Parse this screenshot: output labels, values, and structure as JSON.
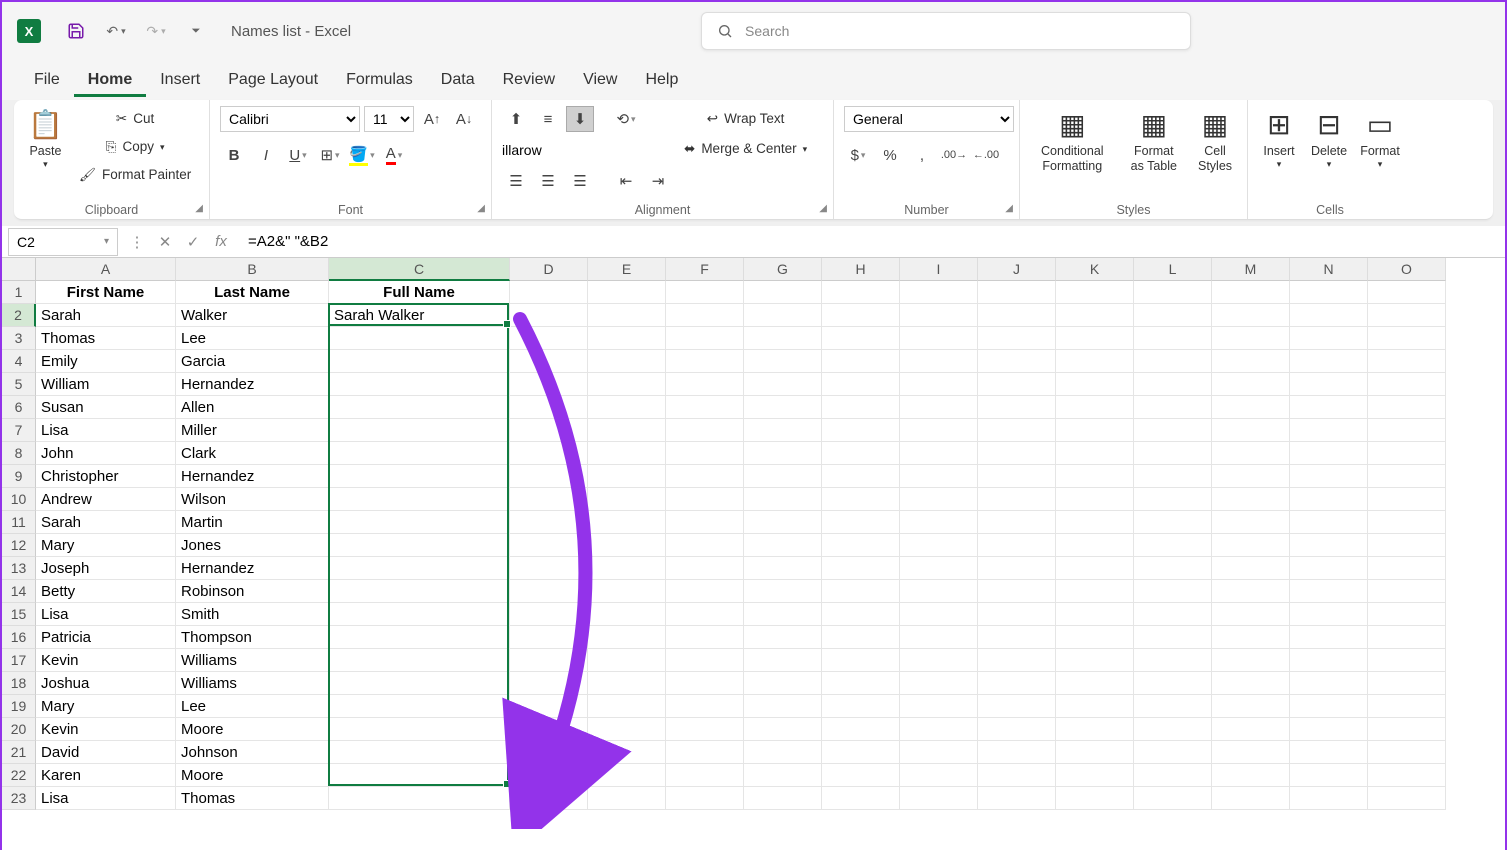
{
  "title": "Names list  -  Excel",
  "search_placeholder": "Search",
  "tabs": [
    "File",
    "Home",
    "Insert",
    "Page Layout",
    "Formulas",
    "Data",
    "Review",
    "View",
    "Help"
  ],
  "active_tab": 1,
  "clipboard": {
    "paste": "Paste",
    "cut": "Cut",
    "copy": "Copy",
    "painter": "Format Painter",
    "label": "Clipboard"
  },
  "font": {
    "name": "Calibri",
    "size": "11",
    "label": "Font"
  },
  "alignment": {
    "wrap": "Wrap Text",
    "merge": "Merge & Center",
    "label": "Alignment"
  },
  "number": {
    "format": "General",
    "label": "Number"
  },
  "styles": {
    "cf": "Conditional Formatting",
    "fat": "Format as Table",
    "cs": "Cell Styles",
    "label": "Styles"
  },
  "cells": {
    "insert": "Insert",
    "delete": "Delete",
    "format": "Format",
    "label": "Cells"
  },
  "name_box": "C2",
  "formula": "=A2&\" \"&B2",
  "col_widths": {
    "A": 140,
    "B": 153,
    "C": 181,
    "other": 78
  },
  "columns": [
    "A",
    "B",
    "C",
    "D",
    "E",
    "F",
    "G",
    "H",
    "I",
    "J",
    "K",
    "L",
    "M",
    "N",
    "O"
  ],
  "headers": [
    "First Name",
    "Last Name",
    "Full Name"
  ],
  "rows": [
    [
      "Sarah",
      "Walker",
      "Sarah Walker"
    ],
    [
      "Thomas",
      "Lee",
      ""
    ],
    [
      "Emily",
      "Garcia",
      ""
    ],
    [
      "William",
      "Hernandez",
      ""
    ],
    [
      "Susan",
      "Allen",
      ""
    ],
    [
      "Lisa",
      "Miller",
      ""
    ],
    [
      "John",
      "Clark",
      ""
    ],
    [
      "Christopher",
      "Hernandez",
      ""
    ],
    [
      "Andrew",
      "Wilson",
      ""
    ],
    [
      "Sarah",
      "Martin",
      ""
    ],
    [
      "Mary",
      "Jones",
      ""
    ],
    [
      "Joseph",
      "Hernandez",
      ""
    ],
    [
      "Betty",
      "Robinson",
      ""
    ],
    [
      "Lisa",
      "Smith",
      ""
    ],
    [
      "Patricia",
      "Thompson",
      ""
    ],
    [
      "Kevin",
      "Williams",
      ""
    ],
    [
      "Joshua",
      "Williams",
      ""
    ],
    [
      "Mary",
      "Lee",
      ""
    ],
    [
      "Kevin",
      "Moore",
      ""
    ],
    [
      "David",
      "Johnson",
      ""
    ],
    [
      "Karen",
      "Moore",
      ""
    ],
    [
      "Lisa",
      "Thomas",
      ""
    ]
  ]
}
